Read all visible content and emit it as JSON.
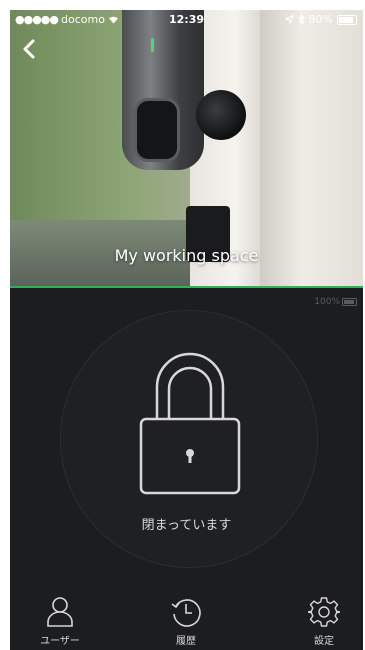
{
  "status_bar": {
    "carrier": "docomo",
    "time": "12:39",
    "battery": "80%"
  },
  "hero": {
    "title": "My working space"
  },
  "device": {
    "battery": "100%"
  },
  "lock": {
    "status": "閉まっています"
  },
  "tabs": [
    {
      "label": "ユーザー",
      "icon": "user-icon"
    },
    {
      "label": "履歴",
      "icon": "history-icon"
    },
    {
      "label": "設定",
      "icon": "gear-icon"
    }
  ],
  "colors": {
    "background": "#1c1d1e",
    "accent_line": "#2fb35a",
    "icon_stroke": "#d8d8d8"
  }
}
